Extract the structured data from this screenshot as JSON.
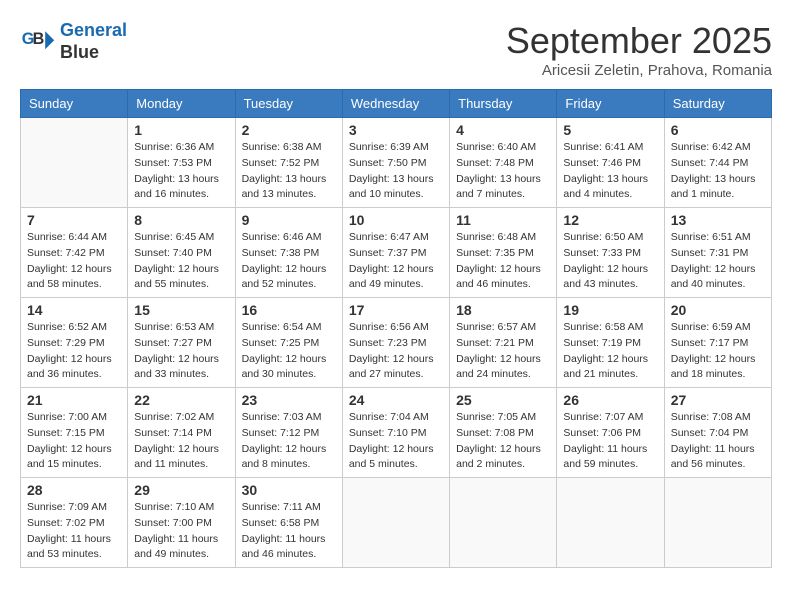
{
  "header": {
    "logo_line1": "General",
    "logo_line2": "Blue",
    "month": "September 2025",
    "location": "Aricesii Zeletin, Prahova, Romania"
  },
  "weekdays": [
    "Sunday",
    "Monday",
    "Tuesday",
    "Wednesday",
    "Thursday",
    "Friday",
    "Saturday"
  ],
  "weeks": [
    [
      {
        "day": "",
        "info": []
      },
      {
        "day": "1",
        "info": [
          "Sunrise: 6:36 AM",
          "Sunset: 7:53 PM",
          "Daylight: 13 hours",
          "and 16 minutes."
        ]
      },
      {
        "day": "2",
        "info": [
          "Sunrise: 6:38 AM",
          "Sunset: 7:52 PM",
          "Daylight: 13 hours",
          "and 13 minutes."
        ]
      },
      {
        "day": "3",
        "info": [
          "Sunrise: 6:39 AM",
          "Sunset: 7:50 PM",
          "Daylight: 13 hours",
          "and 10 minutes."
        ]
      },
      {
        "day": "4",
        "info": [
          "Sunrise: 6:40 AM",
          "Sunset: 7:48 PM",
          "Daylight: 13 hours",
          "and 7 minutes."
        ]
      },
      {
        "day": "5",
        "info": [
          "Sunrise: 6:41 AM",
          "Sunset: 7:46 PM",
          "Daylight: 13 hours",
          "and 4 minutes."
        ]
      },
      {
        "day": "6",
        "info": [
          "Sunrise: 6:42 AM",
          "Sunset: 7:44 PM",
          "Daylight: 13 hours",
          "and 1 minute."
        ]
      }
    ],
    [
      {
        "day": "7",
        "info": [
          "Sunrise: 6:44 AM",
          "Sunset: 7:42 PM",
          "Daylight: 12 hours",
          "and 58 minutes."
        ]
      },
      {
        "day": "8",
        "info": [
          "Sunrise: 6:45 AM",
          "Sunset: 7:40 PM",
          "Daylight: 12 hours",
          "and 55 minutes."
        ]
      },
      {
        "day": "9",
        "info": [
          "Sunrise: 6:46 AM",
          "Sunset: 7:38 PM",
          "Daylight: 12 hours",
          "and 52 minutes."
        ]
      },
      {
        "day": "10",
        "info": [
          "Sunrise: 6:47 AM",
          "Sunset: 7:37 PM",
          "Daylight: 12 hours",
          "and 49 minutes."
        ]
      },
      {
        "day": "11",
        "info": [
          "Sunrise: 6:48 AM",
          "Sunset: 7:35 PM",
          "Daylight: 12 hours",
          "and 46 minutes."
        ]
      },
      {
        "day": "12",
        "info": [
          "Sunrise: 6:50 AM",
          "Sunset: 7:33 PM",
          "Daylight: 12 hours",
          "and 43 minutes."
        ]
      },
      {
        "day": "13",
        "info": [
          "Sunrise: 6:51 AM",
          "Sunset: 7:31 PM",
          "Daylight: 12 hours",
          "and 40 minutes."
        ]
      }
    ],
    [
      {
        "day": "14",
        "info": [
          "Sunrise: 6:52 AM",
          "Sunset: 7:29 PM",
          "Daylight: 12 hours",
          "and 36 minutes."
        ]
      },
      {
        "day": "15",
        "info": [
          "Sunrise: 6:53 AM",
          "Sunset: 7:27 PM",
          "Daylight: 12 hours",
          "and 33 minutes."
        ]
      },
      {
        "day": "16",
        "info": [
          "Sunrise: 6:54 AM",
          "Sunset: 7:25 PM",
          "Daylight: 12 hours",
          "and 30 minutes."
        ]
      },
      {
        "day": "17",
        "info": [
          "Sunrise: 6:56 AM",
          "Sunset: 7:23 PM",
          "Daylight: 12 hours",
          "and 27 minutes."
        ]
      },
      {
        "day": "18",
        "info": [
          "Sunrise: 6:57 AM",
          "Sunset: 7:21 PM",
          "Daylight: 12 hours",
          "and 24 minutes."
        ]
      },
      {
        "day": "19",
        "info": [
          "Sunrise: 6:58 AM",
          "Sunset: 7:19 PM",
          "Daylight: 12 hours",
          "and 21 minutes."
        ]
      },
      {
        "day": "20",
        "info": [
          "Sunrise: 6:59 AM",
          "Sunset: 7:17 PM",
          "Daylight: 12 hours",
          "and 18 minutes."
        ]
      }
    ],
    [
      {
        "day": "21",
        "info": [
          "Sunrise: 7:00 AM",
          "Sunset: 7:15 PM",
          "Daylight: 12 hours",
          "and 15 minutes."
        ]
      },
      {
        "day": "22",
        "info": [
          "Sunrise: 7:02 AM",
          "Sunset: 7:14 PM",
          "Daylight: 12 hours",
          "and 11 minutes."
        ]
      },
      {
        "day": "23",
        "info": [
          "Sunrise: 7:03 AM",
          "Sunset: 7:12 PM",
          "Daylight: 12 hours",
          "and 8 minutes."
        ]
      },
      {
        "day": "24",
        "info": [
          "Sunrise: 7:04 AM",
          "Sunset: 7:10 PM",
          "Daylight: 12 hours",
          "and 5 minutes."
        ]
      },
      {
        "day": "25",
        "info": [
          "Sunrise: 7:05 AM",
          "Sunset: 7:08 PM",
          "Daylight: 12 hours",
          "and 2 minutes."
        ]
      },
      {
        "day": "26",
        "info": [
          "Sunrise: 7:07 AM",
          "Sunset: 7:06 PM",
          "Daylight: 11 hours",
          "and 59 minutes."
        ]
      },
      {
        "day": "27",
        "info": [
          "Sunrise: 7:08 AM",
          "Sunset: 7:04 PM",
          "Daylight: 11 hours",
          "and 56 minutes."
        ]
      }
    ],
    [
      {
        "day": "28",
        "info": [
          "Sunrise: 7:09 AM",
          "Sunset: 7:02 PM",
          "Daylight: 11 hours",
          "and 53 minutes."
        ]
      },
      {
        "day": "29",
        "info": [
          "Sunrise: 7:10 AM",
          "Sunset: 7:00 PM",
          "Daylight: 11 hours",
          "and 49 minutes."
        ]
      },
      {
        "day": "30",
        "info": [
          "Sunrise: 7:11 AM",
          "Sunset: 6:58 PM",
          "Daylight: 11 hours",
          "and 46 minutes."
        ]
      },
      {
        "day": "",
        "info": []
      },
      {
        "day": "",
        "info": []
      },
      {
        "day": "",
        "info": []
      },
      {
        "day": "",
        "info": []
      }
    ]
  ]
}
